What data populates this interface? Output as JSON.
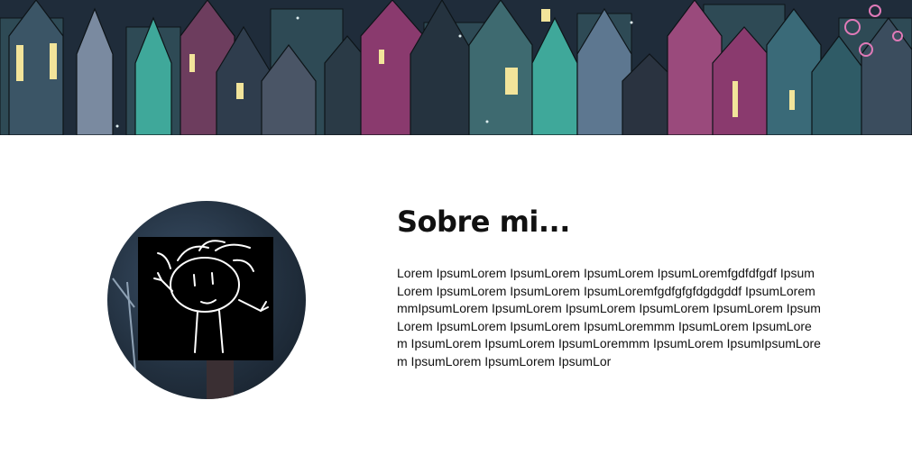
{
  "banner": {
    "icon": "castle-city-illustration"
  },
  "avatar": {
    "icon": "stick-figure-drawing"
  },
  "about": {
    "title": "Sobre mi...",
    "body": "Lorem IpsumLorem IpsumLorem IpsumLorem IpsumLoremfgdfdfgdf IpsumLorem IpsumLorem IpsumLorem IpsumLoremfgdfgfgfdgdgddf IpsumLoremmmIpsumLorem IpsumLorem IpsumLorem IpsumLorem IpsumLorem IpsumLorem IpsumLorem IpsumLorem IpsumLoremmm IpsumLorem IpsumLorem IpsumLorem IpsumLorem IpsumLoremmm IpsumLorem IpsumIpsumLorem IpsumLorem IpsumLorem IpsumLor"
  },
  "colors": {
    "background": "#ffffff",
    "text": "#111111",
    "banner_teal": "#3fa89a",
    "banner_purple": "#8a3a6e"
  }
}
